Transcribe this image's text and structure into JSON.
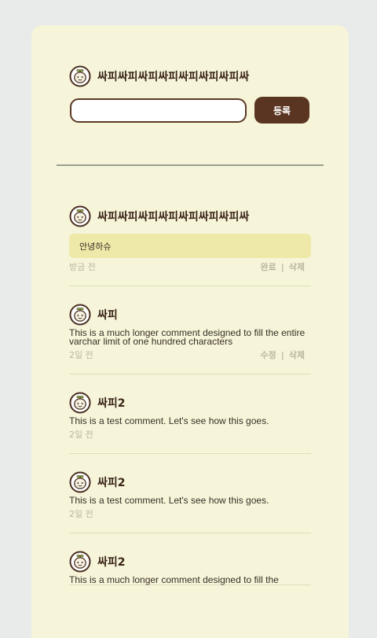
{
  "composer": {
    "user_name": "싸피싸피싸피싸피싸피싸피싸피싸",
    "input_value": "",
    "submit_label": "등록"
  },
  "comments": [
    {
      "user_name": "싸피싸피싸피싸피싸피싸피싸피싸",
      "edit_value": "안녕하슈",
      "time": "방금 전",
      "action_primary": "완료",
      "separator": "|",
      "action_secondary": "삭제"
    },
    {
      "user_name": "싸피",
      "text": "This is a much longer comment designed to fill the entire varchar limit of one hundred characters",
      "time": "2일 전",
      "action_primary": "수정",
      "separator": "|",
      "action_secondary": "삭제"
    },
    {
      "user_name": "싸피2",
      "text": "This is a test comment. Let's see how this goes.",
      "time": "2일 전"
    },
    {
      "user_name": "싸피2",
      "text": "This is a test comment. Let's see how this goes.",
      "time": "2일 전"
    },
    {
      "user_name": "싸피2",
      "text": "This is a much longer comment designed to fill the",
      "time": ""
    }
  ],
  "colors": {
    "page_background": "#e9eaea",
    "card_background": "#f6f5d9",
    "brand_brown": "#5a3521",
    "edit_highlight": "#efe9a9",
    "muted_text": "#b9b8a0"
  },
  "icons": {
    "avatar": "sprout-character-avatar-icon"
  }
}
